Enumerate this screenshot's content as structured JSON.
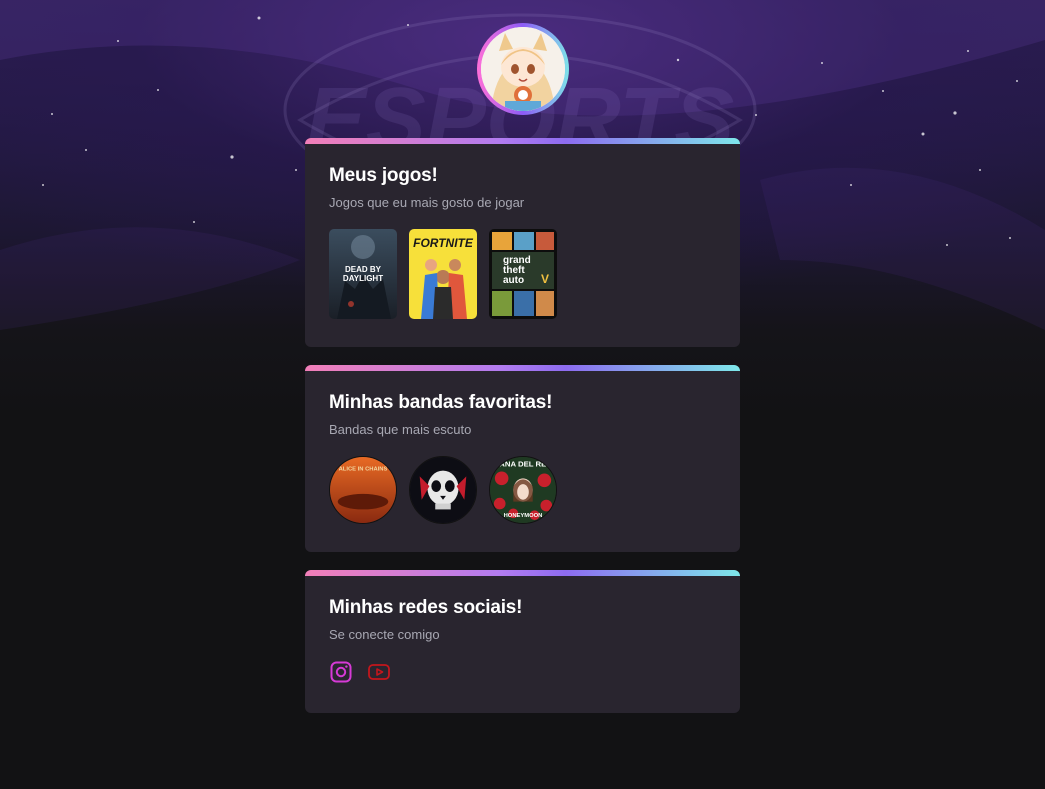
{
  "page": {
    "avatar": "anime-fox-girl-avatar",
    "colors": {
      "background": "#121214",
      "card": "#29252f",
      "gradient_start": "#f27fb8",
      "gradient_mid": "#8d6cf0",
      "gradient_end": "#7ee7ea",
      "instagram": "#d63ad6",
      "youtube": "#c4161c"
    }
  },
  "background": {
    "watermark_text": "ESPORTS"
  },
  "games_card": {
    "title": "Meus jogos!",
    "subtitle": "Jogos que eu mais gosto de jogar",
    "items": [
      {
        "cover_text_1": "DEAD BY",
        "cover_text_2": "DAYLIGHT"
      },
      {
        "cover_text_1": "FORTNITE"
      },
      {
        "cover_text_1": "grand",
        "cover_text_2": "theft",
        "cover_text_3": "auto",
        "cover_text_4": "V"
      }
    ]
  },
  "bands_card": {
    "title": "Minhas bandas favoritas!",
    "subtitle": "Bandas que mais escuto",
    "items": [
      {
        "cover_text": "ALICE IN CHAINS"
      },
      {
        "cover_text": ""
      },
      {
        "cover_text_1": "LANA DEL REY",
        "cover_text_2": "HONEYMOON"
      }
    ]
  },
  "social_card": {
    "title": "Minhas redes sociais!",
    "subtitle": "Se conecte comigo",
    "links": [
      {
        "icon": "instagram-icon"
      },
      {
        "icon": "youtube-icon"
      }
    ]
  }
}
